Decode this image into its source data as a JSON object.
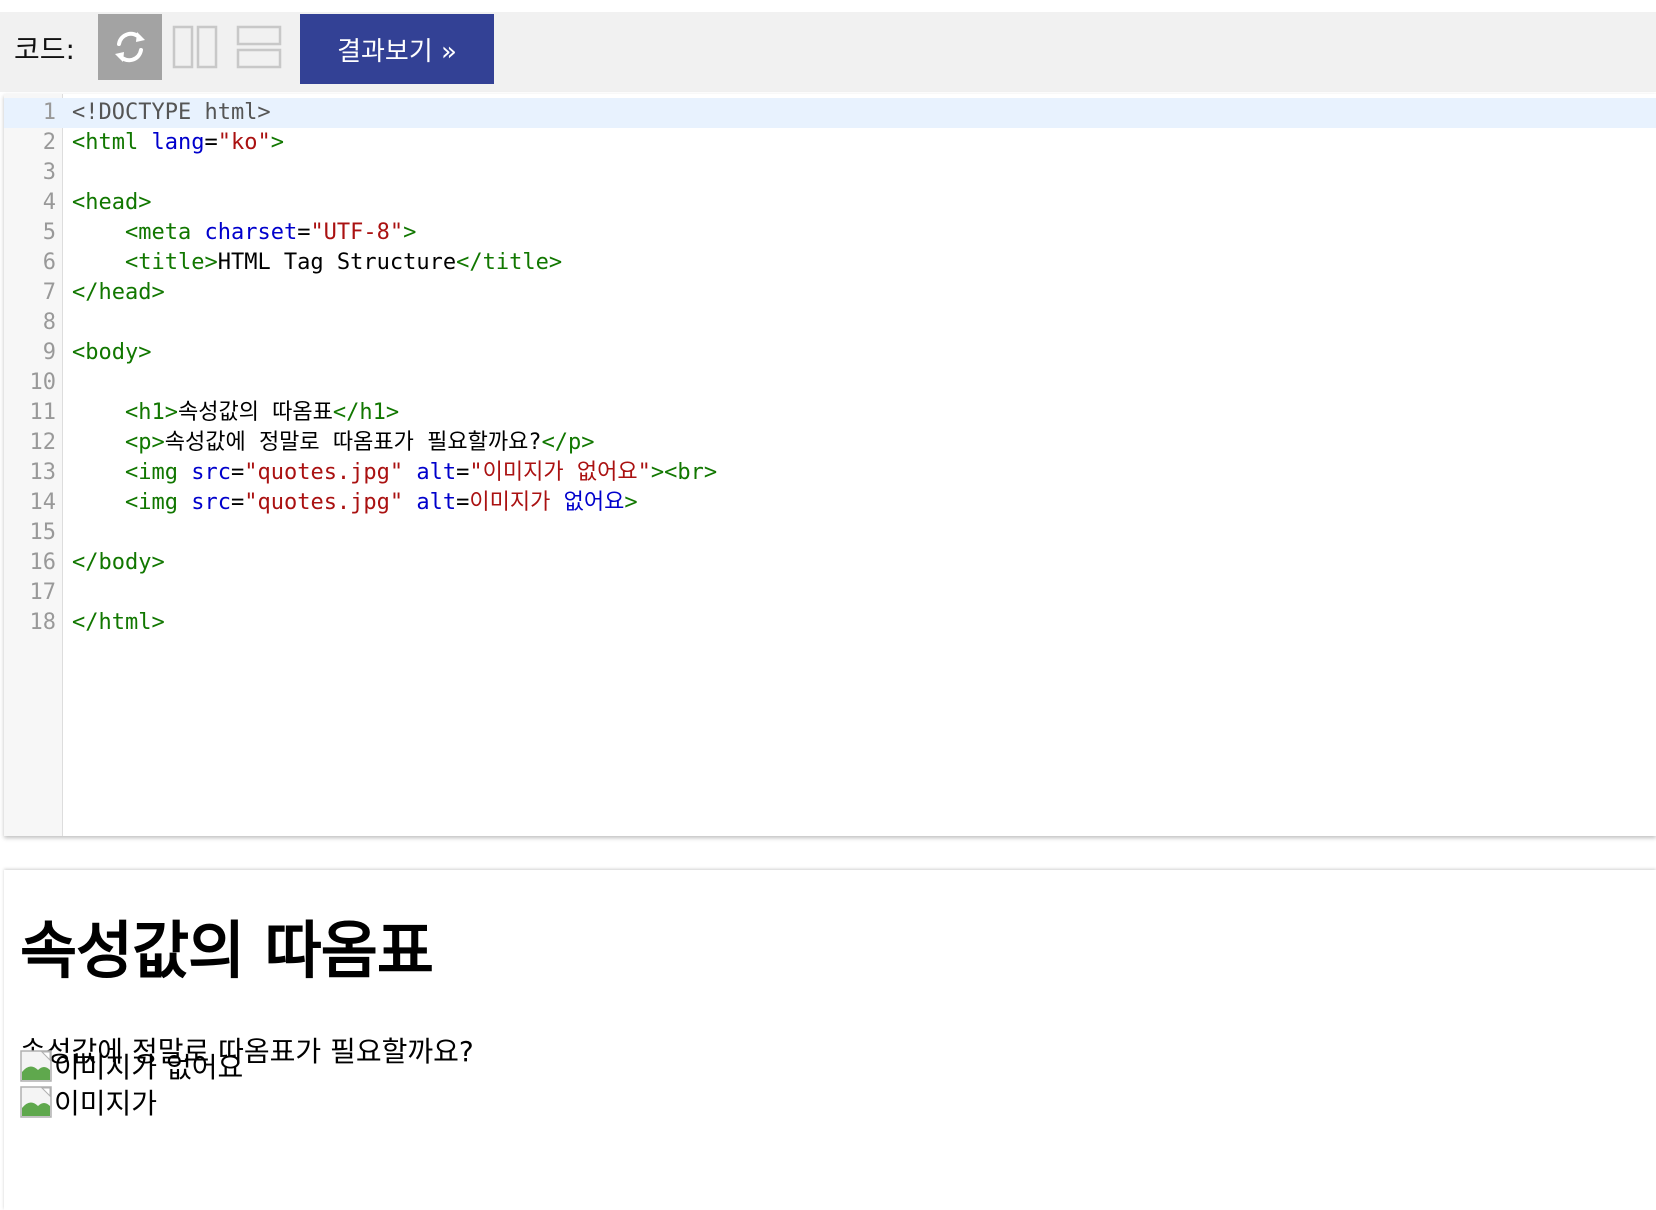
{
  "toolbar": {
    "code_label": "코드:",
    "refresh_icon": "refresh-icon",
    "columns_icon": "two-columns-icon",
    "rows_icon": "two-rows-icon",
    "result_button_label": "결과보기 »",
    "colors": {
      "toolbar_bg": "#f1f1f1",
      "refresh_bg": "#a3a3a3",
      "result_bg": "#334195"
    }
  },
  "editor": {
    "line_numbers": [
      "1",
      "2",
      "3",
      "4",
      "5",
      "6",
      "7",
      "8",
      "9",
      "10",
      "11",
      "12",
      "13",
      "14",
      "15",
      "16",
      "17",
      "18"
    ],
    "lines": [
      [
        {
          "t": "meta",
          "v": "<!DOCTYPE html>"
        }
      ],
      [
        {
          "t": "tag",
          "v": "<html "
        },
        {
          "t": "attr",
          "v": "lang"
        },
        {
          "t": "txt",
          "v": "="
        },
        {
          "t": "str",
          "v": "\"ko\""
        },
        {
          "t": "tag",
          "v": ">"
        }
      ],
      [],
      [
        {
          "t": "tag",
          "v": "<head>"
        }
      ],
      [
        {
          "t": "txt",
          "v": "    "
        },
        {
          "t": "tag",
          "v": "<meta "
        },
        {
          "t": "attr",
          "v": "charset"
        },
        {
          "t": "txt",
          "v": "="
        },
        {
          "t": "str",
          "v": "\"UTF-8\""
        },
        {
          "t": "tag",
          "v": ">"
        }
      ],
      [
        {
          "t": "txt",
          "v": "    "
        },
        {
          "t": "tag",
          "v": "<title>"
        },
        {
          "t": "txt",
          "v": "HTML Tag Structure"
        },
        {
          "t": "tag",
          "v": "</title>"
        }
      ],
      [
        {
          "t": "tag",
          "v": "</head>"
        }
      ],
      [],
      [
        {
          "t": "tag",
          "v": "<body>"
        }
      ],
      [],
      [
        {
          "t": "txt",
          "v": "    "
        },
        {
          "t": "tag",
          "v": "<h1>"
        },
        {
          "t": "txt",
          "v": "속성값의 따옴표"
        },
        {
          "t": "tag",
          "v": "</h1>"
        }
      ],
      [
        {
          "t": "txt",
          "v": "    "
        },
        {
          "t": "tag",
          "v": "<p>"
        },
        {
          "t": "txt",
          "v": "속성값에 정말로 따옴표가 필요할까요?"
        },
        {
          "t": "tag",
          "v": "</p>"
        }
      ],
      [
        {
          "t": "txt",
          "v": "    "
        },
        {
          "t": "tag",
          "v": "<img "
        },
        {
          "t": "attr",
          "v": "src"
        },
        {
          "t": "txt",
          "v": "="
        },
        {
          "t": "str",
          "v": "\"quotes.jpg\""
        },
        {
          "t": "txt",
          "v": " "
        },
        {
          "t": "attr",
          "v": "alt"
        },
        {
          "t": "txt",
          "v": "="
        },
        {
          "t": "str",
          "v": "\"이미지가 없어요\""
        },
        {
          "t": "tag",
          "v": "><br>"
        }
      ],
      [
        {
          "t": "txt",
          "v": "    "
        },
        {
          "t": "tag",
          "v": "<img "
        },
        {
          "t": "attr",
          "v": "src"
        },
        {
          "t": "txt",
          "v": "="
        },
        {
          "t": "str",
          "v": "\"quotes.jpg\""
        },
        {
          "t": "txt",
          "v": " "
        },
        {
          "t": "attr",
          "v": "alt"
        },
        {
          "t": "txt",
          "v": "="
        },
        {
          "t": "str",
          "v": "이미지가 "
        },
        {
          "t": "attr",
          "v": "없어요"
        },
        {
          "t": "tag",
          "v": ">"
        }
      ],
      [],
      [
        {
          "t": "tag",
          "v": "</body>"
        }
      ],
      [],
      [
        {
          "t": "tag",
          "v": "</html>"
        }
      ]
    ],
    "active_line": 1,
    "colors": {
      "tag": "#117700",
      "attr": "#0000cc",
      "string": "#aa1111",
      "active_line_bg": "#e8f2fe"
    }
  },
  "result": {
    "heading": "속성값의 따옴표",
    "paragraph": "속성값에 정말로 따옴표가 필요할까요?",
    "images": [
      {
        "icon": "broken-image-icon",
        "alt": "이미지가 없어요"
      },
      {
        "icon": "broken-image-icon",
        "alt": "이미지가"
      }
    ]
  }
}
